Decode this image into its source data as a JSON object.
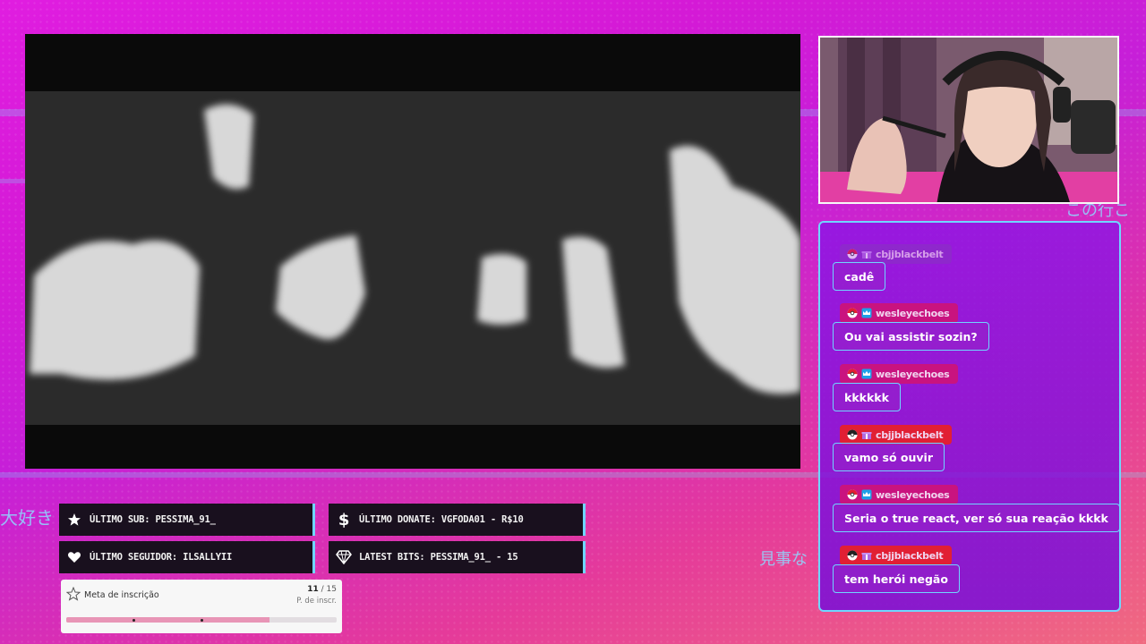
{
  "background": {
    "primary": "#e01de0",
    "accent": "#6fd6ff",
    "bar_bg": "#19101e"
  },
  "decor": {
    "jp_left": "大好き",
    "jp_right_top": "この行こ",
    "jp_right_mid": "見事な"
  },
  "chat": {
    "messages": [
      {
        "user": "cbjjblackbelt",
        "text": "cadê",
        "badge_color": "#c9137f"
      },
      {
        "user": "wesleyechoes",
        "text": "Ou vai assistir sozin?",
        "badge_color": "#c9137f"
      },
      {
        "user": "wesleyechoes",
        "text": "kkkkkk",
        "badge_color": "#c9137f"
      },
      {
        "user": "cbjjblackbelt",
        "text": "vamo só ouvir",
        "badge_color": "#e11f34"
      },
      {
        "user": "wesleyechoes",
        "text": "Seria o true react, ver só sua reação kkkk",
        "badge_color": "#c9137f"
      },
      {
        "user": "cbjjblackbelt",
        "text": "tem herói negão",
        "badge_color": "#e11f34"
      }
    ]
  },
  "info": {
    "last_sub": "Último sub: pessima_91_",
    "last_donate": "Último donate: vgfoda01 - R$10",
    "last_follower": "Último seguidor: ilsallyii",
    "latest_bits": "Latest bits: pessima_91_ - 15"
  },
  "goal": {
    "title": "Meta de inscrição",
    "current": "11",
    "separator": " / ",
    "target": "15",
    "sub_label": "P. de inscr.",
    "progress": 0.75
  }
}
